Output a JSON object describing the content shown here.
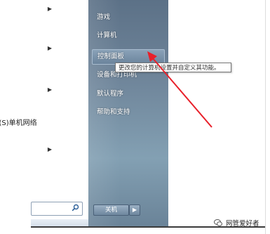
{
  "start_menu": {
    "left_items": [
      {
        "label": "e",
        "has_arrow": true
      },
      {
        "label": "",
        "has_arrow": true
      },
      {
        "label": "",
        "has_arrow": true
      },
      {
        "label": "op(S)单机网络",
        "has_arrow": false
      },
      {
        "label": "",
        "has_arrow": true
      }
    ],
    "search": {
      "placeholder": "",
      "icon": "search-icon"
    },
    "right_items": [
      {
        "label": "游戏"
      },
      {
        "label": "计算机"
      },
      {
        "label": "控制面板"
      },
      {
        "label": "设备和打印机"
      },
      {
        "label": "默认程序"
      },
      {
        "label": "帮助和支持"
      }
    ],
    "shutdown": {
      "label": "关机",
      "arrow": "▶"
    }
  },
  "tooltip": {
    "text": "更改您的计算机设置并自定义其功能。"
  },
  "watermark": {
    "text": "网管爱好者"
  },
  "colors": {
    "arrow": "#e8202a",
    "menu_panel": "#6f859a"
  }
}
